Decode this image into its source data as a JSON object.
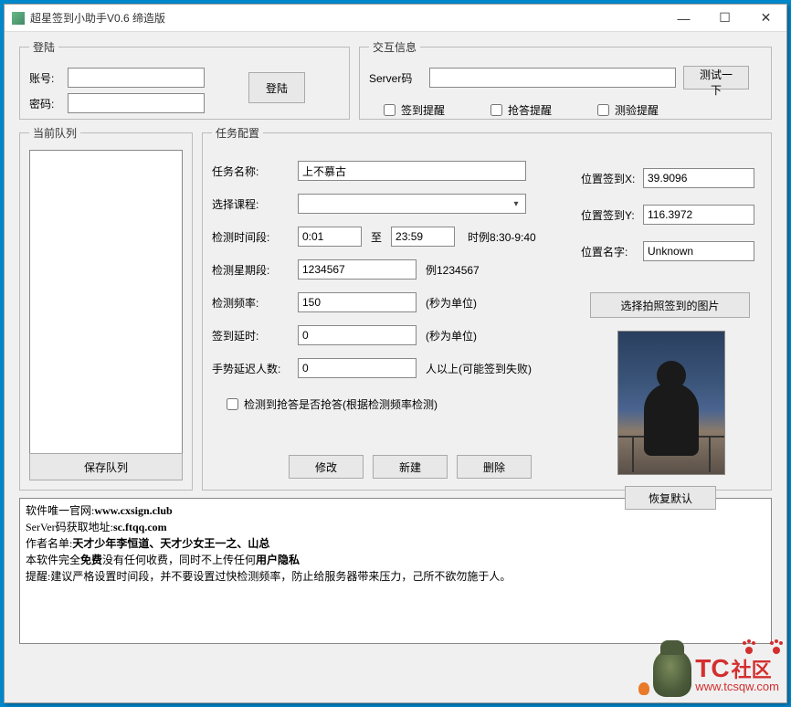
{
  "window": {
    "title": "超星签到小助手V0.6 缔造版"
  },
  "login": {
    "legend": "登陆",
    "account_label": "账号:",
    "password_label": "密码:",
    "button": "登陆",
    "account_value": "",
    "password_value": ""
  },
  "interact": {
    "legend": "交互信息",
    "server_label": "Server码",
    "test_button": "测试一下",
    "server_value": "",
    "cb_signin": "签到提醒",
    "cb_answer": "抢答提醒",
    "cb_exam": "测验提醒"
  },
  "queue": {
    "legend": "当前队列",
    "save_button": "保存队列"
  },
  "config": {
    "legend": "任务配置",
    "task_name_label": "任务名称:",
    "task_name_value": "上不慕古",
    "course_label": "选择课程:",
    "time_label": "检测时间段:",
    "time_from": "0:01",
    "time_to_word": "至",
    "time_to": "23:59",
    "time_example": "时例8:30-9:40",
    "week_label": "检测星期段:",
    "week_value": "1234567",
    "week_example": "例1234567",
    "freq_label": "检测频率:",
    "freq_value": "150",
    "freq_unit": "(秒为单位)",
    "delay_label": "签到延时:",
    "delay_value": "0",
    "delay_unit": "(秒为单位)",
    "gesture_label": "手势延迟人数:",
    "gesture_value": "0",
    "gesture_unit": "人以上(可能签到失败)",
    "cb_autoanswer": "检测到抢答是否抢答(根据检测频率检测)",
    "btn_modify": "修改",
    "btn_new": "新建",
    "btn_delete": "删除"
  },
  "location": {
    "x_label": "位置签到X:",
    "x_value": "39.9096",
    "y_label": "位置签到Y:",
    "y_value": "116.3972",
    "name_label": "位置名字:",
    "name_value": "Unknown",
    "photo_btn": "选择拍照签到的图片",
    "restore_btn": "恢复默认"
  },
  "notes": {
    "l1a": "软件唯一官网:",
    "l1b": "www.cxsign.club",
    "l2a": "SerVer码获取地址:",
    "l2b": "sc.ftqq.com",
    "l3a": "作者名单:",
    "l3b": "天才少年李恒道、天才少女王一之、山总",
    "l4a": "本软件完全",
    "l4b": "免费",
    "l4c": "没有任何收费，同时不上传任何",
    "l4d": "用户隐私",
    "l5": "提醒:建议严格设置时间段，并不要设置过快检测频率，防止给服务器带来压力，己所不欲勿施于人。"
  },
  "watermark": {
    "tc": "TC",
    "cn": "社区",
    "url": "www.tcsqw.com"
  }
}
